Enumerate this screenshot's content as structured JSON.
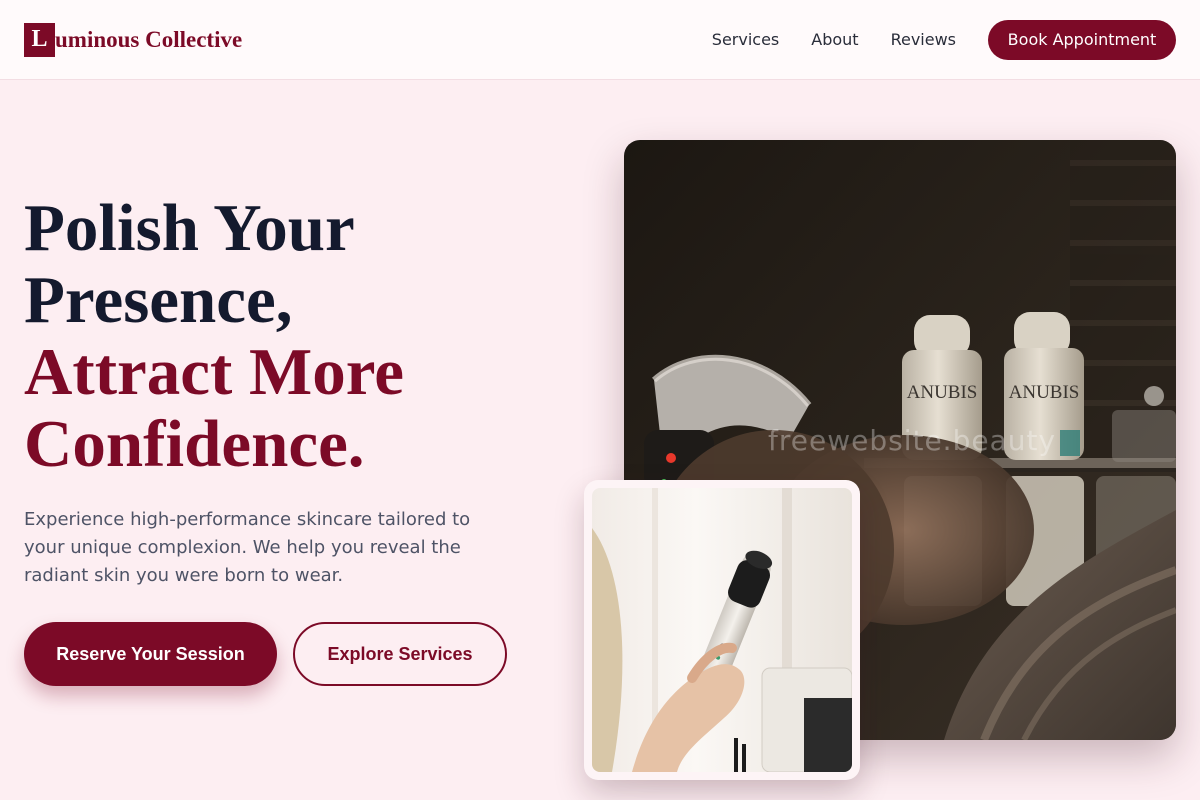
{
  "brand": {
    "mark": "L",
    "name": "uminous Collective",
    "color": "#7c0a27"
  },
  "nav": {
    "links": [
      "Services",
      "About",
      "Reviews"
    ],
    "cta": "Book Appointment"
  },
  "hero": {
    "title_line1": "Polish Your",
    "title_line2": "Presence,",
    "title_line3": "Attract More",
    "title_line4": "Confidence.",
    "subtitle": "Experience high-performance skincare tailored to your unique complexion. We help you reveal the radiant skin you were born to wear.",
    "primary_button": "Reserve Your Session",
    "secondary_button": "Explore Services"
  },
  "images": {
    "main_alt": "Facial treatment with skincare bottles",
    "bottle_label": "ANUBIS",
    "watermark": "freewebsite.beauty",
    "secondary_alt": "Hand holding skincare device"
  },
  "colors": {
    "accent": "#7c0a27",
    "background": "#fdeef2",
    "heading": "#141a2e",
    "body_text": "#4e5366"
  }
}
